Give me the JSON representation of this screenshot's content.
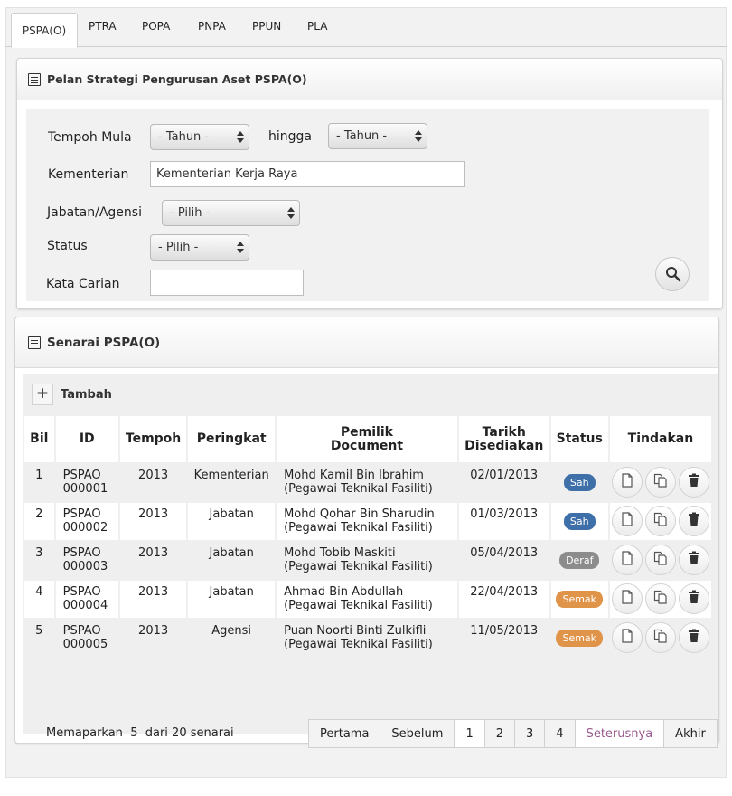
{
  "tabs": [
    "PSPA(O)",
    "PTRA",
    "POPA",
    "PNPA",
    "PPUN",
    "PLA"
  ],
  "search_panel": {
    "title": "Pelan Strategi Pengurusan Aset PSPA(O)",
    "tempoh_mula_label": "Tempoh Mula",
    "tahun_from": "- Tahun -",
    "hingga_label": "hingga",
    "tahun_to": "- Tahun -",
    "kementerian_label": "Kementerian",
    "kementerian_value": "Kementerian Kerja Raya",
    "jabatan_label": "Jabatan/Agensi",
    "jabatan_value": "- Pilih -",
    "status_label": "Status",
    "status_value": "- Pilih -",
    "kata_carian_label": "Kata Carian",
    "kata_carian_value": ""
  },
  "list_panel": {
    "title": "Senarai PSPA(O)",
    "add_label": "Tambah",
    "columns": {
      "bil": "Bil",
      "id": "ID",
      "tempoh": "Tempoh",
      "peringkat": "Peringkat",
      "pemilik_1": "Pemilik",
      "pemilik_2": "Document",
      "tarikh_1": "Tarikh",
      "tarikh_2": "Disediakan",
      "status": "Status",
      "tindakan": "Tindakan"
    },
    "rows": [
      {
        "bil": "1",
        "id1": "PSPAO",
        "id2": "000001",
        "tempoh": "2013",
        "peringkat": "Kementerian",
        "nama": "Mohd Kamil Bin Ibrahim",
        "jawatan": "(Pegawai Teknikal Fasiliti)",
        "tarikh": "02/01/2013",
        "status": "Sah",
        "status_color": "#3e6fa8"
      },
      {
        "bil": "2",
        "id1": "PSPAO",
        "id2": "000002",
        "tempoh": "2013",
        "peringkat": "Jabatan",
        "nama": "Mohd Qohar Bin Sharudin",
        "jawatan": "(Pegawai Teknikal Fasiliti)",
        "tarikh": "01/03/2013",
        "status": "Sah",
        "status_color": "#3e6fa8"
      },
      {
        "bil": "3",
        "id1": "PSPAO",
        "id2": "000003",
        "tempoh": "2013",
        "peringkat": "Jabatan",
        "nama": "Mohd Tobib Maskiti",
        "jawatan": "(Pegawai Teknikal Fasiliti)",
        "tarikh": "05/04/2013",
        "status": "Deraf",
        "status_color": "#8c8c8c"
      },
      {
        "bil": "4",
        "id1": "PSPAO",
        "id2": "000004",
        "tempoh": "2013",
        "peringkat": "Jabatan",
        "nama": "Ahmad Bin Abdullah",
        "jawatan": "(Pegawai Teknikal Fasiliti)",
        "tarikh": "22/04/2013",
        "status": "Semak",
        "status_color": "#e0944a"
      },
      {
        "bil": "5",
        "id1": "PSPAO",
        "id2": "000005",
        "tempoh": "2013",
        "peringkat": "Agensi",
        "nama": "Puan Noorti Binti Zulkifli",
        "jawatan": "(Pegawai Teknikal Fasiliti)",
        "tarikh": "11/05/2013",
        "status": "Semak",
        "status_color": "#e0944a"
      }
    ],
    "actions": [
      "view-icon",
      "copy-icon",
      "trash-icon"
    ],
    "showing": {
      "prefix": "Memaparkan",
      "count": "5",
      "suffix": "dari 20 senarai"
    },
    "pager": [
      "Pertama",
      "Sebelum",
      "1",
      "2",
      "3",
      "4",
      "Seterusnya",
      "Akhir"
    ],
    "current_page": "1"
  }
}
